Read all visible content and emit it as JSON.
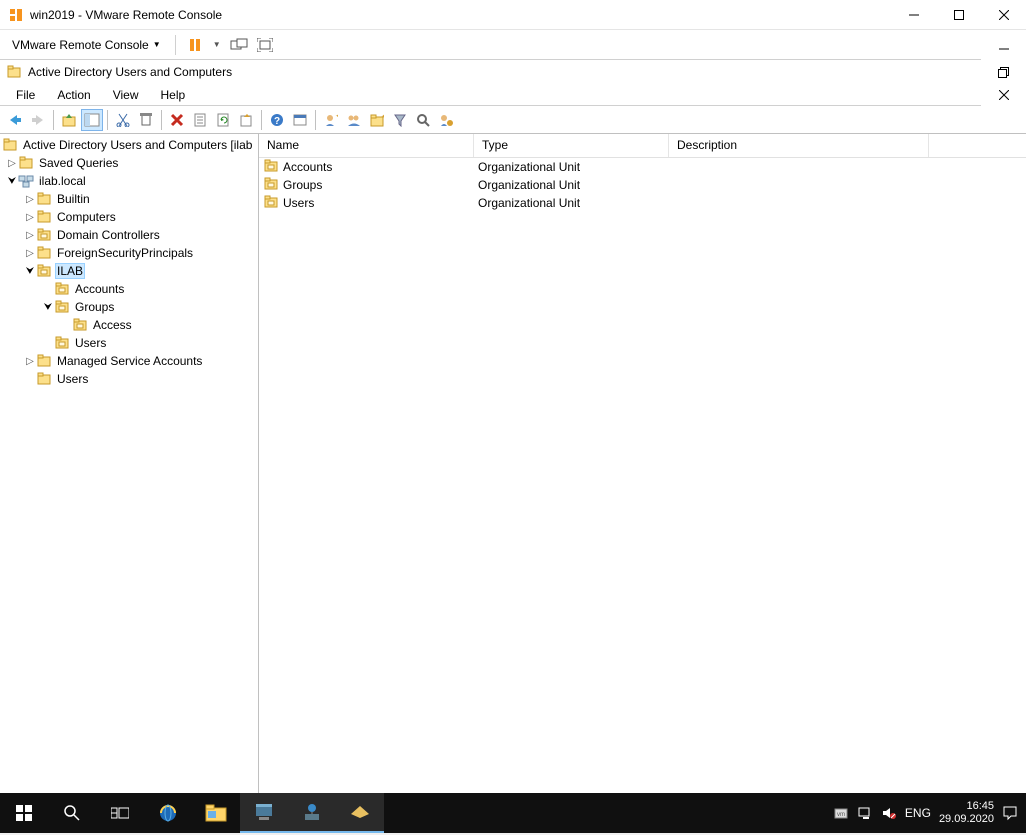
{
  "vmrc": {
    "title": "win2019 - VMware Remote Console",
    "menu_label": "VMware Remote Console"
  },
  "aduc": {
    "title": "Active Directory Users and Computers",
    "menu": {
      "file": "File",
      "action": "Action",
      "view": "View",
      "help": "Help"
    },
    "tree": {
      "root": "Active Directory Users and Computers [ilab",
      "saved_queries": "Saved Queries",
      "domain": "ilab.local",
      "builtin": "Builtin",
      "computers": "Computers",
      "domain_controllers": "Domain Controllers",
      "fsp": "ForeignSecurityPrincipals",
      "ilab": "ILAB",
      "ilab_accounts": "Accounts",
      "ilab_groups": "Groups",
      "ilab_groups_access": "Access",
      "ilab_users": "Users",
      "msa": "Managed Service Accounts",
      "users": "Users"
    },
    "list": {
      "headers": {
        "name": "Name",
        "type": "Type",
        "description": "Description"
      },
      "rows": [
        {
          "name": "Accounts",
          "type": "Organizational Unit",
          "description": ""
        },
        {
          "name": "Groups",
          "type": "Organizational Unit",
          "description": ""
        },
        {
          "name": "Users",
          "type": "Organizational Unit",
          "description": ""
        }
      ]
    }
  },
  "taskbar": {
    "lang": "ENG",
    "time": "16:45",
    "date": "29.09.2020"
  }
}
